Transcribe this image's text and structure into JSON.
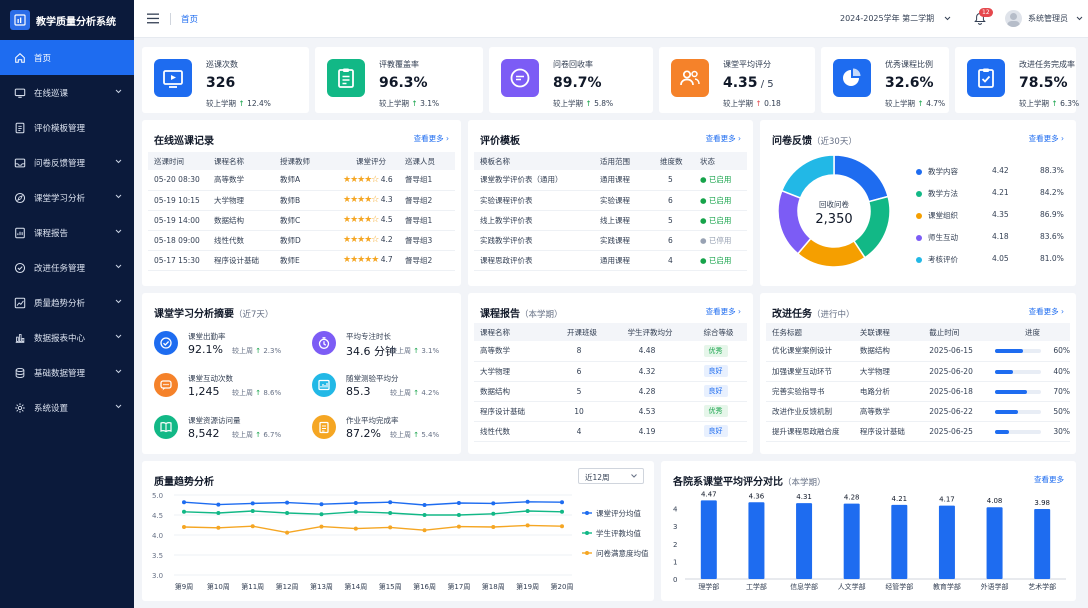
{
  "app": {
    "title": "教学质量分析系统"
  },
  "sidebar": {
    "items": [
      {
        "label": "首页",
        "icon": "home-icon",
        "active": true,
        "expandable": false
      },
      {
        "label": "在线巡课",
        "icon": "monitor-icon",
        "expandable": true
      },
      {
        "label": "评价模板管理",
        "icon": "document-icon",
        "expandable": false
      },
      {
        "label": "问卷反馈管理",
        "icon": "inbox-icon",
        "expandable": true
      },
      {
        "label": "课堂学习分析",
        "icon": "compass-icon",
        "expandable": true
      },
      {
        "label": "课程报告",
        "icon": "report-icon",
        "expandable": true
      },
      {
        "label": "改进任务管理",
        "icon": "task-icon",
        "expandable": true
      },
      {
        "label": "质量趋势分析",
        "icon": "trend-icon",
        "expandable": true
      },
      {
        "label": "数据报表中心",
        "icon": "bar-chart-icon",
        "expandable": true
      },
      {
        "label": "基础数据管理",
        "icon": "database-icon",
        "expandable": true
      },
      {
        "label": "系统设置",
        "icon": "gear-icon",
        "expandable": true
      }
    ]
  },
  "topbar": {
    "breadcrumb": "首页",
    "term": "2024-2025学年 第二学期",
    "notification_count": "12",
    "user": "系统管理员"
  },
  "stats": [
    {
      "label": "巡课次数",
      "value": "326",
      "unit": "",
      "compare": "较上学期",
      "change": "12.4%",
      "dir": "up",
      "color": "#1e6cf0",
      "icon": "play-screen-icon"
    },
    {
      "label": "评教覆盖率",
      "value": "96.3%",
      "unit": "",
      "compare": "较上学期",
      "change": "3.1%",
      "dir": "up",
      "color": "#12b886",
      "icon": "clipboard-icon"
    },
    {
      "label": "问卷回收率",
      "value": "89.7%",
      "unit": "",
      "compare": "较上学期",
      "change": "5.8%",
      "dir": "up",
      "color": "#7c5cf5",
      "icon": "chat-icon"
    },
    {
      "label": "课堂平均评分",
      "value": "4.35",
      "unit": " / 5",
      "compare": "较上学期",
      "change": "0.18",
      "dir": "down",
      "color": "#f5822a",
      "icon": "users-icon"
    },
    {
      "label": "优秀课程比例",
      "value": "32.6%",
      "unit": "",
      "compare": "较上学期",
      "change": "4.7%",
      "dir": "up",
      "color": "#1e6cf0",
      "icon": "pie-icon"
    },
    {
      "label": "改进任务完成率",
      "value": "78.5%",
      "unit": "",
      "compare": "较上学期",
      "change": "6.3%",
      "dir": "up",
      "color": "#1e6cf0",
      "icon": "checklist-icon"
    }
  ],
  "inspection": {
    "title": "在线巡课记录",
    "more": "查看更多 ›",
    "columns": [
      "巡课时间",
      "课程名称",
      "授课教师",
      "课堂评分",
      "巡课人员"
    ],
    "rows": [
      {
        "time": "05-20 08:30",
        "course": "高等数学",
        "teacher": "教师A",
        "stars": "★★★★☆",
        "score": "4.6",
        "group": "督导组1"
      },
      {
        "time": "05-19 10:15",
        "course": "大学物理",
        "teacher": "教师B",
        "stars": "★★★★☆",
        "score": "4.3",
        "group": "督导组2"
      },
      {
        "time": "05-19 14:00",
        "course": "数据结构",
        "teacher": "教师C",
        "stars": "★★★★☆",
        "score": "4.5",
        "group": "督导组1"
      },
      {
        "time": "05-18 09:00",
        "course": "线性代数",
        "teacher": "教师D",
        "stars": "★★★★☆",
        "score": "4.2",
        "group": "督导组3"
      },
      {
        "time": "05-17 15:30",
        "course": "程序设计基础",
        "teacher": "教师E",
        "stars": "★★★★★",
        "score": "4.7",
        "group": "督导组2"
      }
    ]
  },
  "templates": {
    "title": "评价模板",
    "more": "查看更多 ›",
    "columns": [
      "模板名称",
      "适用范围",
      "维度数",
      "状态"
    ],
    "rows": [
      {
        "name": "课堂教学评价表（通用）",
        "scope": "通用课程",
        "dims": "5",
        "status": "● 已启用",
        "on": true
      },
      {
        "name": "实验课程评价表",
        "scope": "实验课程",
        "dims": "6",
        "status": "● 已启用",
        "on": true
      },
      {
        "name": "线上教学评价表",
        "scope": "线上课程",
        "dims": "5",
        "status": "● 已启用",
        "on": true
      },
      {
        "name": "实践教学评价表",
        "scope": "实践课程",
        "dims": "6",
        "status": "● 已停用",
        "on": false
      },
      {
        "name": "课程思政评价表",
        "scope": "通用课程",
        "dims": "4",
        "status": "● 已启用",
        "on": true
      }
    ]
  },
  "survey": {
    "title": "问卷反馈",
    "subtitle": "（近30天）",
    "more": "查看更多 ›",
    "center_label": "回收问卷",
    "center_value": "2,350",
    "items": [
      {
        "name": "教学内容",
        "score": "4.42",
        "pct": 88.3,
        "pct_label": "88.3%",
        "color": "#1e6cf0"
      },
      {
        "name": "教学方法",
        "score": "4.21",
        "pct": 84.2,
        "pct_label": "84.2%",
        "color": "#12b886"
      },
      {
        "name": "课堂组织",
        "score": "4.35",
        "pct": 86.9,
        "pct_label": "86.9%",
        "color": "#f59f00"
      },
      {
        "name": "师生互动",
        "score": "4.18",
        "pct": 83.6,
        "pct_label": "83.6%",
        "color": "#7c5cf5"
      },
      {
        "name": "考核评价",
        "score": "4.05",
        "pct": 81.0,
        "pct_label": "81.0%",
        "color": "#22b8e6"
      }
    ]
  },
  "classroom": {
    "title": "课堂学习分析摘要",
    "subtitle": "（近7天）",
    "metrics": [
      {
        "label": "课堂出勤率",
        "value": "92.1%",
        "compare": "较上周",
        "change": "2.3%",
        "color": "#1e6cf0",
        "icon": "attendance-icon"
      },
      {
        "label": "平均专注时长",
        "value": "34.6 分钟",
        "compare": "较上周",
        "change": "3.1%",
        "color": "#7c5cf5",
        "icon": "timer-icon"
      },
      {
        "label": "课堂互动次数",
        "value": "1,245",
        "compare": "较上周",
        "change": "8.6%",
        "color": "#f5822a",
        "icon": "interaction-icon"
      },
      {
        "label": "随堂测验平均分",
        "value": "85.3",
        "compare": "较上周",
        "change": "4.2%",
        "color": "#22b8e6",
        "icon": "quiz-icon"
      },
      {
        "label": "课堂资源访问量",
        "value": "8,542",
        "compare": "较上周",
        "change": "6.7%",
        "color": "#12b886",
        "icon": "book-icon"
      },
      {
        "label": "作业平均完成率",
        "value": "87.2%",
        "compare": "较上周",
        "change": "5.4%",
        "color": "#f5a623",
        "icon": "homework-icon"
      }
    ]
  },
  "reports": {
    "title": "课程报告",
    "subtitle": "（本学期）",
    "more": "查看更多 ›",
    "columns": [
      "课程名称",
      "开课班级",
      "学生评教均分",
      "综合等级"
    ],
    "rows": [
      {
        "course": "高等数学",
        "classes": "8",
        "score": "4.48",
        "grade": "优秀",
        "ex": true
      },
      {
        "course": "大学物理",
        "classes": "6",
        "score": "4.32",
        "grade": "良好",
        "ex": false
      },
      {
        "course": "数据结构",
        "classes": "5",
        "score": "4.28",
        "grade": "良好",
        "ex": false
      },
      {
        "course": "程序设计基础",
        "classes": "10",
        "score": "4.53",
        "grade": "优秀",
        "ex": true
      },
      {
        "course": "线性代数",
        "classes": "4",
        "score": "4.19",
        "grade": "良好",
        "ex": false
      }
    ]
  },
  "tasks": {
    "title": "改进任务",
    "subtitle": "（进行中）",
    "more": "查看更多 ›",
    "columns": [
      "任务标题",
      "关联课程",
      "截止时间",
      "进度"
    ],
    "rows": [
      {
        "title": "优化课堂案例设计",
        "course": "数据结构",
        "due": "2025-06-15",
        "progress": 60,
        "label": "60%"
      },
      {
        "title": "加强课堂互动环节",
        "course": "大学物理",
        "due": "2025-06-20",
        "progress": 40,
        "label": "40%"
      },
      {
        "title": "完善实验指导书",
        "course": "电路分析",
        "due": "2025-06-18",
        "progress": 70,
        "label": "70%"
      },
      {
        "title": "改进作业反馈机制",
        "course": "高等数学",
        "due": "2025-06-22",
        "progress": 50,
        "label": "50%"
      },
      {
        "title": "提升课程思政融合度",
        "course": "程序设计基础",
        "due": "2025-06-25",
        "progress": 30,
        "label": "30%"
      }
    ]
  },
  "trend": {
    "title": "质量趋势分析",
    "select": "近12周"
  },
  "dept": {
    "title": "各院系课堂平均评分对比",
    "subtitle": "（本学期）",
    "more": "查看更多"
  },
  "chart_data": [
    {
      "type": "line",
      "x": [
        "第9周",
        "第10周",
        "第11周",
        "第12周",
        "第13周",
        "第14周",
        "第15周",
        "第16周",
        "第17周",
        "第18周",
        "第19周",
        "第20周"
      ],
      "ylim": [
        3.0,
        5.0
      ],
      "yticks": [
        3.0,
        3.5,
        4.0,
        4.5,
        5.0
      ],
      "series": [
        {
          "name": "课堂评分均值",
          "color": "#1e6cf0",
          "values": [
            4.82,
            4.76,
            4.79,
            4.81,
            4.77,
            4.8,
            4.82,
            4.75,
            4.8,
            4.79,
            4.83,
            4.82
          ]
        },
        {
          "name": "学生评教均值",
          "color": "#12b886",
          "values": [
            4.58,
            4.55,
            4.6,
            4.55,
            4.52,
            4.58,
            4.55,
            4.5,
            4.5,
            4.53,
            4.6,
            4.58
          ]
        },
        {
          "name": "问卷满意度均值",
          "color": "#f5a623",
          "values": [
            4.2,
            4.18,
            4.22,
            4.06,
            4.21,
            4.16,
            4.19,
            4.12,
            4.21,
            4.2,
            4.24,
            4.22
          ]
        }
      ],
      "legend": "right"
    },
    {
      "type": "bar",
      "categories": [
        "理学部",
        "工学部",
        "信息学部",
        "人文学部",
        "经管学部",
        "教育学部",
        "外语学部",
        "艺术学部"
      ],
      "values": [
        4.47,
        4.36,
        4.31,
        4.28,
        4.21,
        4.17,
        4.08,
        3.98
      ],
      "labels": [
        "4.47",
        "4.36",
        "4.31",
        "4.28",
        "4.21",
        "4.17",
        "4.08",
        "3.98"
      ],
      "ylim": [
        0,
        5
      ],
      "yticks": [
        0,
        1,
        2,
        3,
        4
      ],
      "color": "#1e6cf0"
    }
  ]
}
